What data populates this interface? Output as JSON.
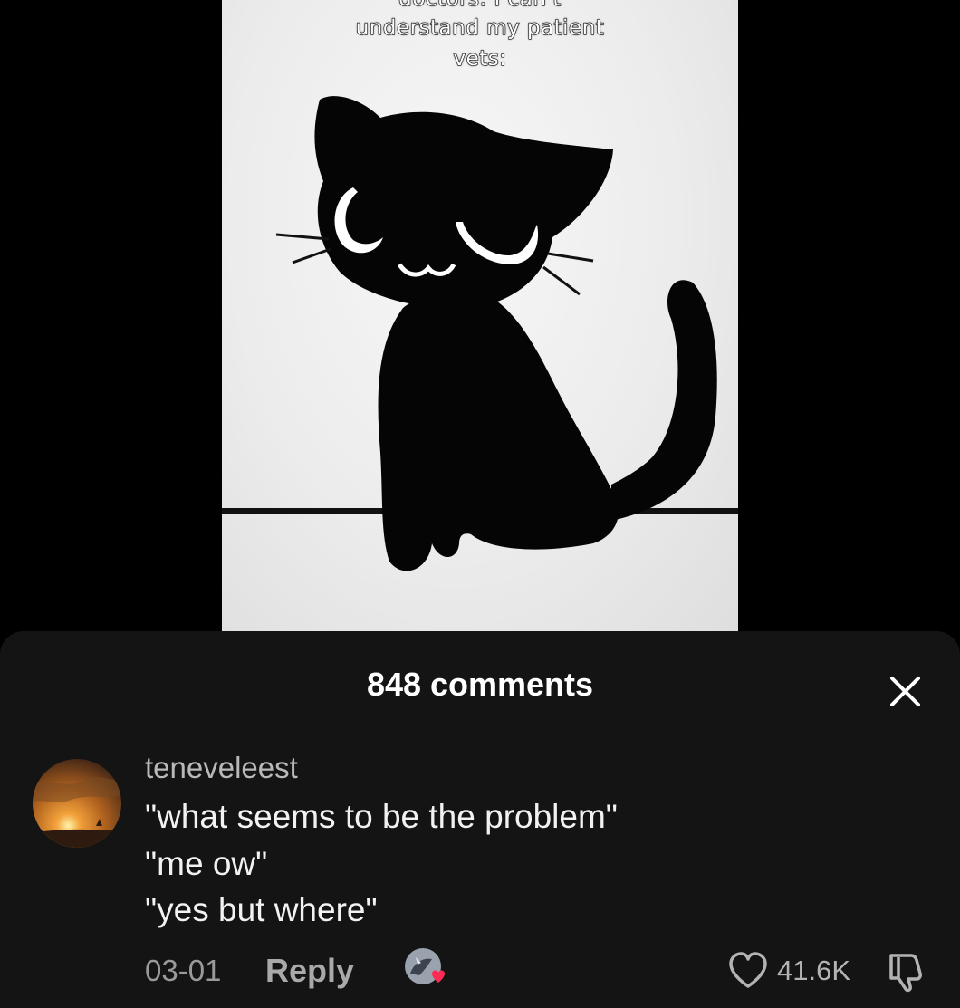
{
  "video": {
    "caption_lines": [
      "doctors: I can't",
      "understand my patient",
      "vets:"
    ]
  },
  "comments_panel": {
    "title": "848 comments",
    "close_icon": "close-icon"
  },
  "comment": {
    "username": "teneveleest",
    "lines": [
      "\"what seems to be the problem\"",
      "\"me ow\"",
      "\"yes but where\""
    ],
    "date": "03-01",
    "reply_label": "Reply",
    "like_count": "41.6K",
    "icons": {
      "like": "heart-outline-icon",
      "dislike": "thumbs-down-icon",
      "creator_liked": "creator-avatar-heart-icon",
      "avatar": "sunset-avatar"
    }
  },
  "colors": {
    "sheet_bg": "#141414",
    "page_bg": "#000000",
    "text_primary": "#f2f2f2",
    "text_secondary": "#9a9a9a",
    "heart_red": "#fe2c55"
  }
}
